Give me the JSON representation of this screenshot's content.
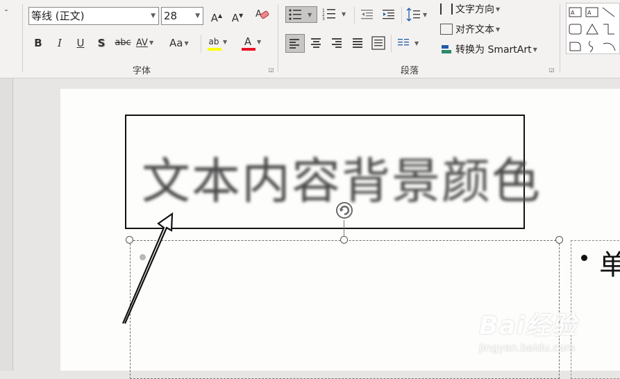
{
  "ribbon": {
    "font_group": {
      "font_name": "等线 (正文)",
      "font_size": "28",
      "grow_label": "A",
      "shrink_label": "A",
      "bold": "B",
      "italic": "I",
      "underline": "U",
      "shadow": "S",
      "strikethrough": "abc",
      "spacing": "AV",
      "change_case": "Aa",
      "highlight": "ab",
      "font_color": "A",
      "label": "字体",
      "highlight_color": "#ffff00",
      "font_color_value": "#e81123"
    },
    "paragraph_group": {
      "label": "段落",
      "text_direction": "文字方向",
      "align_text": "对齐文本",
      "convert_smartart": "转换为 SmartArt"
    }
  },
  "slide": {
    "title_text": "文本内容背景颜色",
    "right_text": "单"
  },
  "watermark": {
    "brand": "Bai经验",
    "url": "jingyan.baidu.com"
  },
  "colors": {
    "ribbon_bg": "#f3f2f1",
    "slide_bg": "#fdfdfb",
    "accent_red": "#e81123",
    "highlight_yellow": "#ffff00"
  }
}
